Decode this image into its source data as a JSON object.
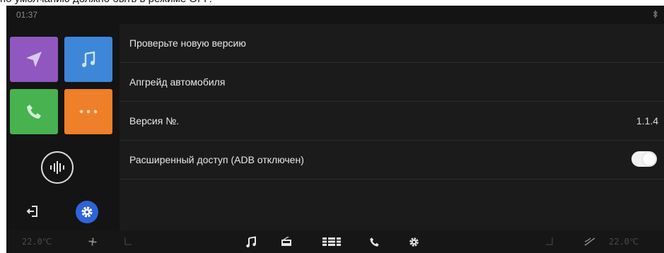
{
  "caption": "по умолчанию должно быть в режиме OFF.",
  "status_bar": {
    "time": "01:37",
    "bluetooth_icon": "bluetooth-icon"
  },
  "sidebar": {
    "tiles": [
      {
        "name": "navigation",
        "icon": "navigation-arrow-icon",
        "color": "#8f57bf"
      },
      {
        "name": "music",
        "icon": "music-note-icon",
        "color": "#3e87d8"
      },
      {
        "name": "phone",
        "icon": "phone-icon",
        "color": "#47b24f"
      },
      {
        "name": "more",
        "icon": "more-dots-icon",
        "color": "#ef7f28"
      }
    ],
    "voice_icon": "voice-assistant-icon",
    "exit_icon": "exit-icon",
    "settings_icon": "gear-icon",
    "settings_active_color": "#2f63d8"
  },
  "settings_list": {
    "rows": [
      {
        "label": "Проверьте новую версию"
      },
      {
        "label": "Апгрейд автомобиля"
      },
      {
        "label": "Версия №.",
        "value": "1.1.4"
      },
      {
        "label": "Расширенный доступ (ADB отключен)",
        "toggle": "on"
      }
    ]
  },
  "bottom_bar": {
    "left_temp": "22.0℃",
    "right_temp": "22.0℃",
    "icons": [
      "fan-icon",
      "seat-heat-left-icon",
      "music-note-icon",
      "radio-icon",
      "apps-grid-icon",
      "phone-icon",
      "gear-icon",
      "seat-heat-right-icon",
      "airflow-icon"
    ]
  }
}
